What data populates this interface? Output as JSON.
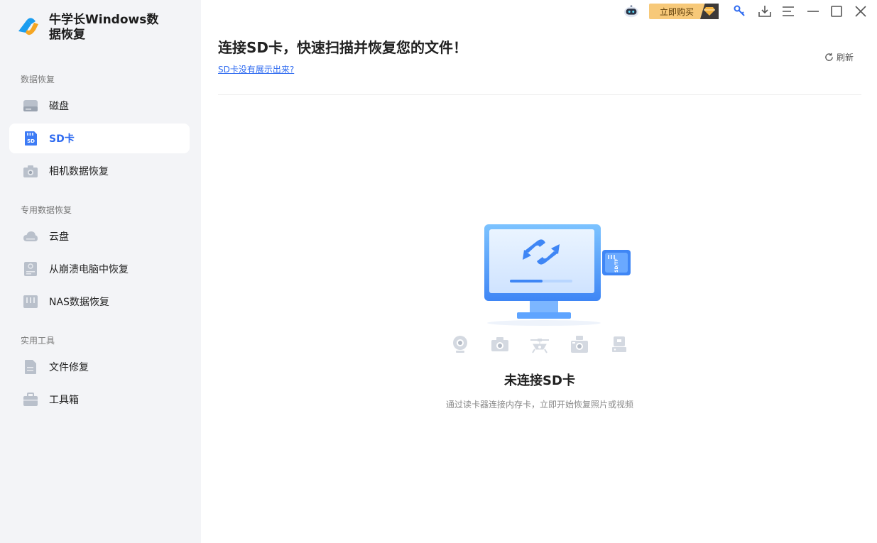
{
  "app": {
    "name": "牛学长Windows数据恢复"
  },
  "sidebar": {
    "sections": [
      {
        "title": "数据恢复"
      },
      {
        "title": "专用数据恢复"
      },
      {
        "title": "实用工具"
      }
    ],
    "items": [
      {
        "label": "磁盘",
        "icon": "disk-icon"
      },
      {
        "label": "SD卡",
        "icon": "sd-card-icon",
        "active": true
      },
      {
        "label": "相机数据恢复",
        "icon": "camera-icon"
      },
      {
        "label": "云盘",
        "icon": "cloud-icon"
      },
      {
        "label": "从崩溃电脑中恢复",
        "icon": "crashed-pc-icon"
      },
      {
        "label": "NAS数据恢复",
        "icon": "nas-icon"
      },
      {
        "label": "文件修复",
        "icon": "file-repair-icon"
      },
      {
        "label": "工具箱",
        "icon": "toolbox-icon"
      }
    ]
  },
  "titlebar": {
    "buy_label": "立即购买"
  },
  "main": {
    "title": "连接SD卡，快速扫描并恢复您的文件！",
    "help_link": "SD卡没有展示出来?",
    "refresh_label": "刷新",
    "sd_label": "SD/TF",
    "empty_title": "未连接SD卡",
    "empty_subtitle": "通过读卡器连接内存卡，立即开始恢复照片或视频"
  },
  "colors": {
    "accent": "#2f6bf0",
    "sidebar_bg": "#f3f4f7",
    "buy_bg": "#f7c979"
  }
}
